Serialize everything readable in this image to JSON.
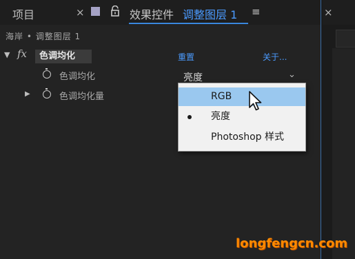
{
  "tabs": {
    "project": "项目",
    "close_symbol": "×",
    "effects_controls_prefix": "效果控件",
    "effects_controls_layer": "调整图层 1",
    "menu_symbol": "≡"
  },
  "breadcrumb": "海岸 • 调整图层 1",
  "effect": {
    "fx_label": "fx",
    "name": "色调均化",
    "reset_label": "重置",
    "about_label": "关于...",
    "properties": [
      {
        "label": "色调均化",
        "value": "亮度"
      },
      {
        "label": "色调均化量"
      }
    ]
  },
  "dropdown": {
    "chevron": "⌄",
    "options": [
      {
        "label": "RGB",
        "highlighted": true,
        "selected": false
      },
      {
        "label": "亮度",
        "highlighted": false,
        "selected": true
      },
      {
        "label": "Photoshop 样式",
        "highlighted": false,
        "selected": false
      }
    ]
  },
  "watermark": "longfengcn.com",
  "colors": {
    "accent": "#4b9bff",
    "menu_highlight": "#9ac8ef",
    "watermark": "#ff8a00",
    "panel_bg": "#232323"
  },
  "icons": {
    "lock": "lock-icon",
    "stopwatch": "stopwatch-icon",
    "expand": "triangle-icon",
    "cursor": "pointer-cursor-icon"
  }
}
